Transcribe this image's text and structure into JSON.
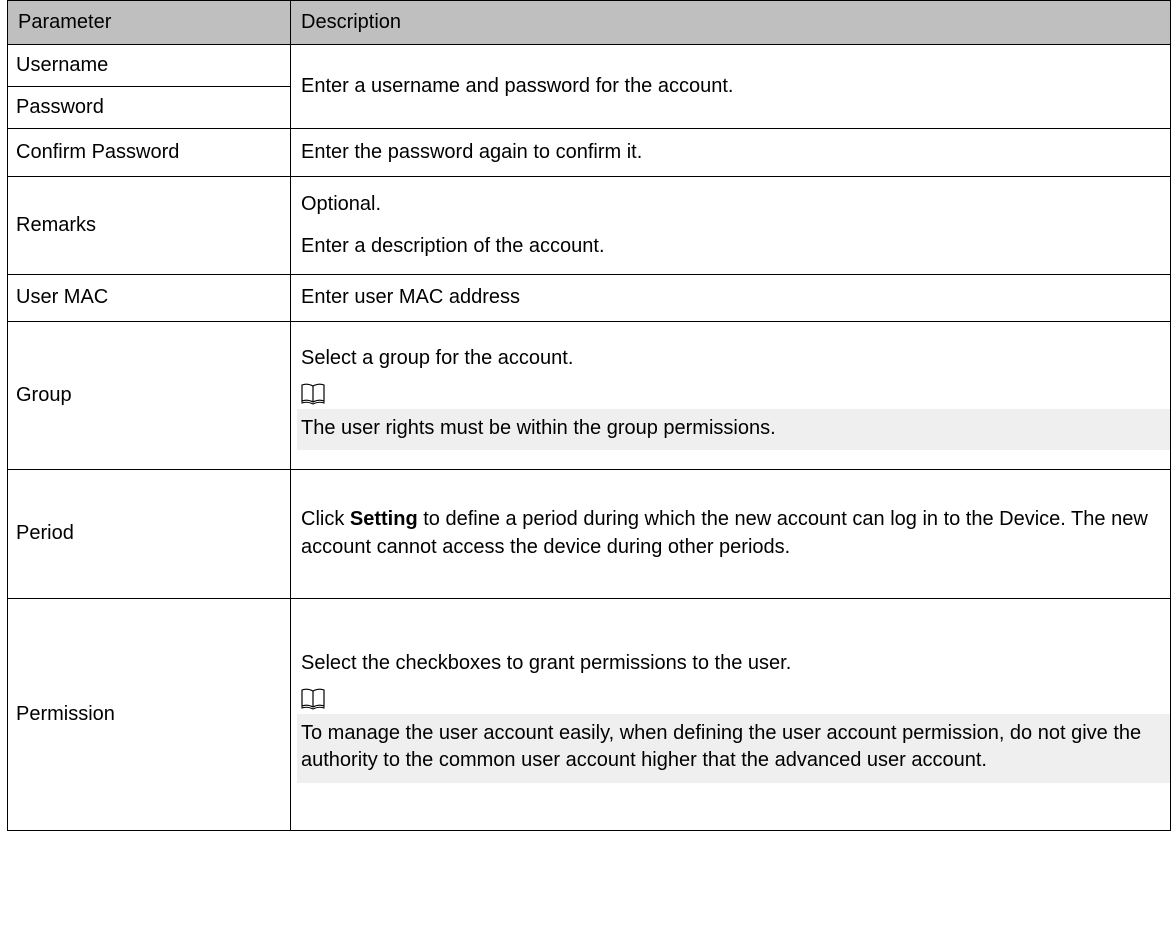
{
  "table": {
    "headers": {
      "parameter": "Parameter",
      "description": "Description"
    },
    "rows": {
      "username": {
        "name": "Username"
      },
      "password": {
        "name": "Password"
      },
      "username_password_desc": "Enter a username and password for the account.",
      "confirm_password": {
        "name": "Confirm Password",
        "desc": "Enter the password again to confirm it."
      },
      "remarks": {
        "name": "Remarks",
        "desc_1": "Optional.",
        "desc_2": "Enter a description of the account."
      },
      "user_mac": {
        "name": "User MAC",
        "desc": "Enter user MAC address"
      },
      "group": {
        "name": "Group",
        "desc": "Select a group for the account.",
        "note": "The user rights must be within the group permissions."
      },
      "period": {
        "name": "Period",
        "desc_prefix": "Click ",
        "desc_bold": "Setting",
        "desc_suffix": " to define a period during which the new account can log in to the Device. The new account cannot access the device during other periods."
      },
      "permission": {
        "name": "Permission",
        "desc": "Select the checkboxes to grant permissions to the user.",
        "note": "To manage the user account easily, when defining the user account permission, do not give the authority to the common user account higher that the advanced user account."
      }
    }
  },
  "icons": {
    "note": "book-note-icon"
  },
  "colors": {
    "header_bg": "#bfbfbf",
    "note_bg": "#efefef",
    "border": "#000000"
  }
}
